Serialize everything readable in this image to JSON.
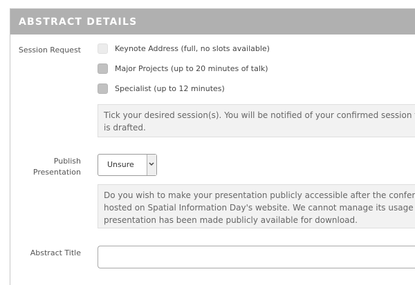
{
  "panel": {
    "title": "ABSTRACT DETAILS"
  },
  "session_request": {
    "label": "Session Request",
    "options": [
      {
        "label": "Keynote Address (full, no slots available)",
        "disabled": true
      },
      {
        "label": "Major Projects (up to 20 minutes of talk)",
        "disabled": false
      },
      {
        "label": "Specialist (up to 12 minutes)",
        "disabled": false
      }
    ],
    "help_lines": [
      "Tick your desired session(s). You will be notified of your confirmed session type when t",
      "is drafted."
    ]
  },
  "publish": {
    "label_line1": "Publish",
    "label_line2": "Presentation",
    "selected_value": "Unsure",
    "help_lines": [
      "Do you wish to make your presentation publicly accessible after the conference? If so,",
      "hosted on Spatial Information Day's website. We cannot manage its usage by others o",
      "presentation has been made publicly available for download."
    ]
  },
  "abstract_title": {
    "label": "Abstract Title",
    "value": ""
  },
  "colors": {
    "header_bg": "#b0b0b0",
    "help_bg": "#f2f2f2"
  }
}
